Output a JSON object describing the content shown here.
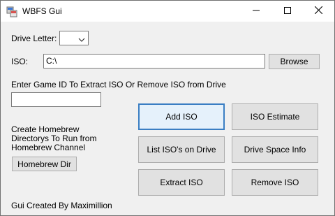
{
  "window": {
    "title": "WBFS Gui"
  },
  "drive": {
    "label": "Drive Letter:",
    "value": ""
  },
  "iso": {
    "label": "ISO:",
    "path": "C:\\",
    "browse_label": "Browse"
  },
  "game_id": {
    "label": "Enter Game ID To Extract ISO Or Remove ISO from Drive",
    "value": ""
  },
  "homebrew": {
    "line1": "Create Homebrew",
    "line2": "Directorys To Run from",
    "line3": "Homebrew Channel",
    "button_label": "Homebrew Dir"
  },
  "actions": {
    "add_iso": "Add ISO",
    "iso_estimate": "ISO Estimate",
    "list_isos": "List ISO's on Drive",
    "drive_space": "Drive Space Info",
    "extract_iso": "Extract ISO",
    "remove_iso": "Remove ISO"
  },
  "footer": {
    "credit": "Gui Created By Maximillion"
  },
  "colors": {
    "focus_border": "#3a7ec3",
    "window_bg": "#f0f0f0",
    "button_bg": "#e1e1e1"
  }
}
